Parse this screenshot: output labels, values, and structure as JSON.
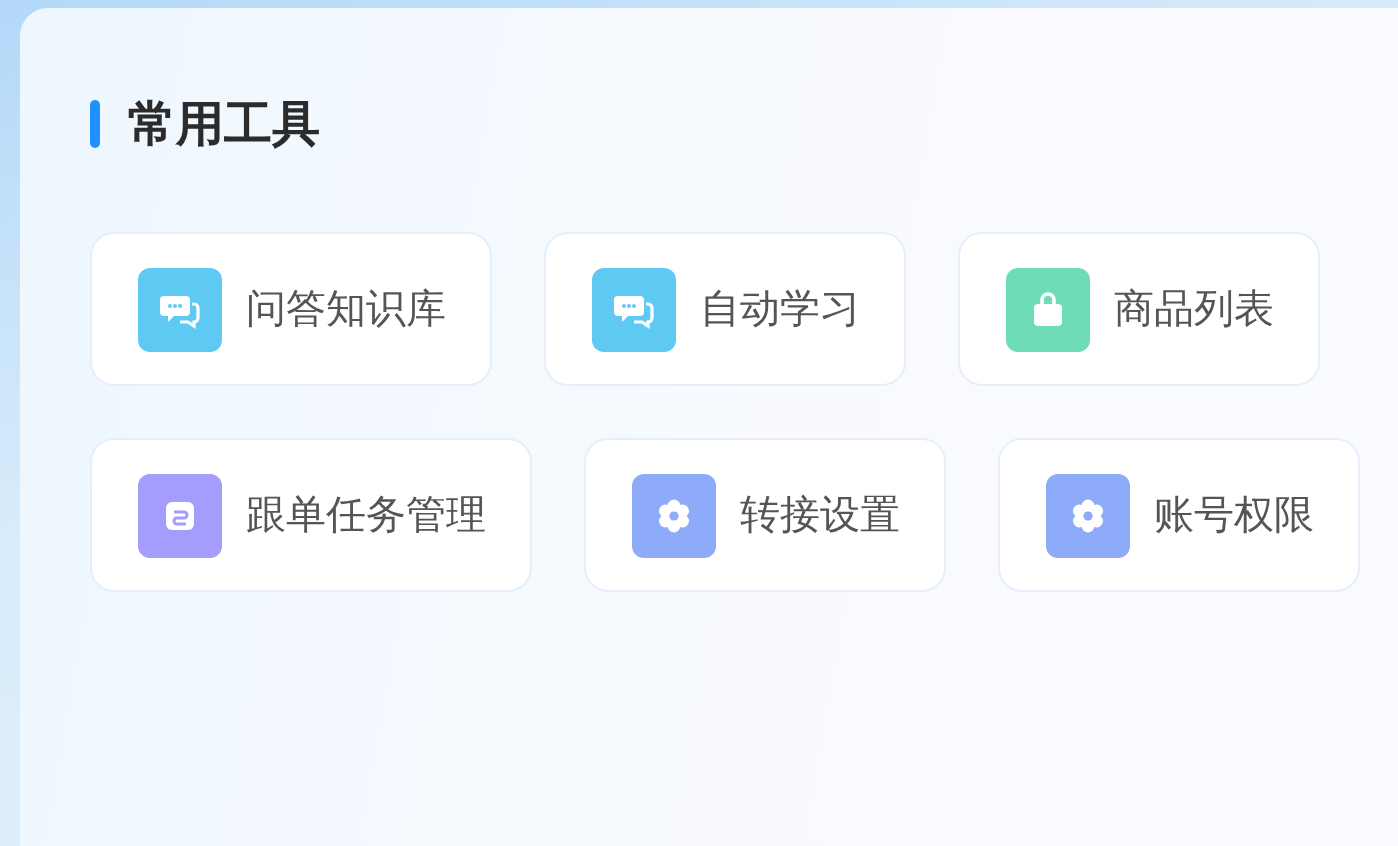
{
  "section": {
    "title": "常用工具"
  },
  "tool_rows": [
    [
      {
        "label": "问答知识库",
        "kind": "chat",
        "color": "#5ecaf4"
      },
      {
        "label": "自动学习",
        "kind": "chat",
        "color": "#5ecaf4"
      },
      {
        "label": "商品列表",
        "kind": "bag",
        "color": "#6fdcb8"
      }
    ],
    [
      {
        "label": "跟单任务管理",
        "kind": "loop",
        "color": "#a49dfd"
      },
      {
        "label": "转接设置",
        "kind": "gear",
        "color": "#8dabf9"
      },
      {
        "label": "账号权限",
        "kind": "gear",
        "color": "#8dabf9"
      }
    ]
  ]
}
